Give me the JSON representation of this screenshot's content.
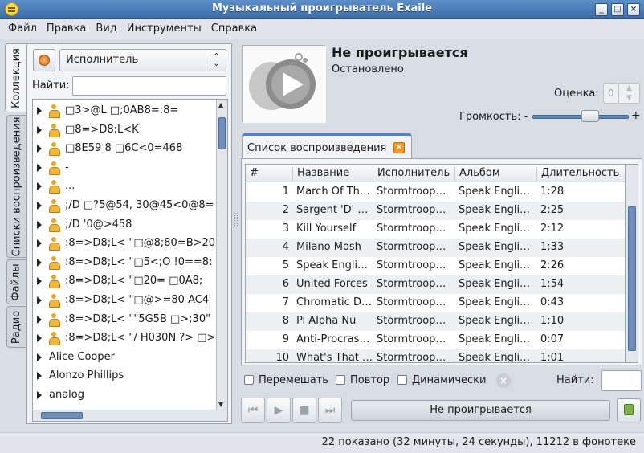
{
  "window": {
    "title": "Музыкальный проигрыватель Exaile"
  },
  "menu": [
    {
      "label": "Файл"
    },
    {
      "label": "Правка"
    },
    {
      "label": "Вид"
    },
    {
      "label": "Инструменты"
    },
    {
      "label": "Справка"
    }
  ],
  "side_tabs": [
    {
      "label": "Коллекция"
    },
    {
      "label": "Списки воспроизведения"
    },
    {
      "label": "Файлы"
    },
    {
      "label": "Радио"
    }
  ],
  "collection": {
    "view_by": "Исполнитель",
    "find_label": "Найти:",
    "find_value": "",
    "items": [
      {
        "text": "□3>@L □;0AB8=:8=",
        "icon": "artist-icon"
      },
      {
        "text": "□8=>D8;L<K",
        "icon": "artist-icon"
      },
      {
        "text": "□8E59 8 □6C<0=468",
        "icon": "artist-icon"
      },
      {
        "text": "-",
        "icon": "artist-icon"
      },
      {
        "text": "...",
        "icon": "artist-icon"
      },
      {
        "text": ";/D □?5@54, 30@45<0@8=",
        "icon": "artist-icon"
      },
      {
        "text": ";/D '0@>458",
        "icon": "artist-icon"
      },
      {
        "text": ":8=>D8;L< \"□@8;80=B>20",
        "icon": "artist-icon"
      },
      {
        "text": ":8=>D8;L< \"□5<;O !0==8:",
        "icon": "artist-icon"
      },
      {
        "text": ":8=>D8;L< \"□20= □0A8;",
        "icon": "artist-icon"
      },
      {
        "text": ":8=>D8;L< \"□@>=80 AC4",
        "icon": "artist-icon"
      },
      {
        "text": ":8=>D8;L< \"\"5G5B □>;30\"",
        "icon": "artist-icon"
      },
      {
        "text": ":8=>D8;L< \"/ H030N ?> □>",
        "icon": "artist-icon"
      },
      {
        "text": "Alice Cooper",
        "icon": "none"
      },
      {
        "text": "Alonzo Phillips",
        "icon": "none"
      },
      {
        "text": "analog",
        "icon": "none"
      }
    ]
  },
  "now_playing": {
    "title": "Не проигрывается",
    "status": "Остановлено",
    "rating_label": "Оценка:",
    "rating_value": "0",
    "volume_label": "Громкость:",
    "volume_minus": "-",
    "volume_plus": "+",
    "volume_level": 0.6
  },
  "playlist": {
    "tab_label": "Список воспроизведения",
    "columns": [
      "#",
      "Название",
      "Исполнитель",
      "Альбом",
      "Длительность"
    ],
    "rows": [
      {
        "num": "1",
        "title": "March Of Th…",
        "artist": "Stormtroop…",
        "album": "Speak Engli…",
        "length": "1:28"
      },
      {
        "num": "2",
        "title": "Sargent 'D' …",
        "artist": "Stormtroop…",
        "album": "Speak Engli…",
        "length": "2:25"
      },
      {
        "num": "3",
        "title": "Kill Yourself",
        "artist": "Stormtroop…",
        "album": "Speak Engli…",
        "length": "2:12"
      },
      {
        "num": "4",
        "title": "Milano Mosh",
        "artist": "Stormtroop…",
        "album": "Speak Engli…",
        "length": "1:33"
      },
      {
        "num": "5",
        "title": "Speak Engli…",
        "artist": "Stormtroop…",
        "album": "Speak Engli…",
        "length": "2:26"
      },
      {
        "num": "6",
        "title": "United Forces",
        "artist": "Stormtroop…",
        "album": "Speak Engli…",
        "length": "1:54"
      },
      {
        "num": "7",
        "title": "Chromatic D…",
        "artist": "Stormtroop…",
        "album": "Speak Engli…",
        "length": "0:43"
      },
      {
        "num": "8",
        "title": "Pi Alpha Nu",
        "artist": "Stormtroop…",
        "album": "Speak Engli…",
        "length": "1:10"
      },
      {
        "num": "9",
        "title": "Anti-Procras…",
        "artist": "Stormtroop…",
        "album": "Speak Engli…",
        "length": "0:07"
      },
      {
        "num": "10",
        "title": "What's That …",
        "artist": "Stormtroop…",
        "album": "Speak Engli…",
        "length": "1:01"
      }
    ],
    "shuffle_label": "Перемешать",
    "repeat_label": "Повтор",
    "dynamic_label": "Динамически",
    "find_label": "Найти:"
  },
  "controls": {
    "status_button": "Не проигрывается"
  },
  "statusbar": {
    "text": "22 показано (32 минуты, 24 секунды), 11212 в фонотеке"
  },
  "colors": {
    "titlebar": "#4a7cba",
    "accent": "#4a86d0",
    "scrollbar": "#6f8fb9"
  }
}
